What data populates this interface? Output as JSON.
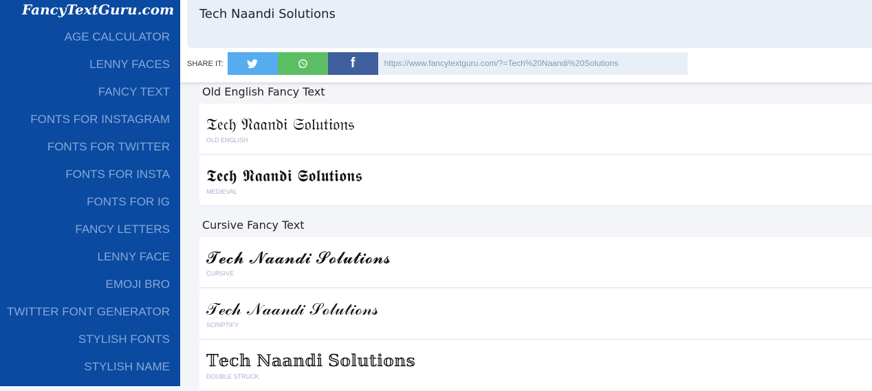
{
  "logo": "FancyTextGuru.com",
  "menu": [
    "AGE CALCULATOR",
    "LENNY FACES",
    "FANCY TEXT",
    "FONTS FOR INSTAGRAM",
    "FONTS FOR TWITTER",
    "FONTS FOR INSTA",
    "FONTS FOR IG",
    "FANCY LETTERS",
    "LENNY FACE",
    "EMOJI BRO",
    "TWITTER FONT GENERATOR",
    "STYLISH FONTS",
    "STYLISH NAME"
  ],
  "input": {
    "value": "Tech Naandi Solutions"
  },
  "share": {
    "label": "SHARE IT:",
    "url": "https://www.fancytextguru.com/?=Tech%20Naandi%20Solutions",
    "colors": {
      "twitter": "#55acee",
      "whatsapp": "#5cbe63",
      "facebook": "#3f5f9e"
    }
  },
  "sections": [
    {
      "title": "Old English Fancy Text",
      "items": [
        {
          "text": "𝔗𝔢𝔠𝔥 𝔑𝔞𝔞𝔫𝔡𝔦 𝔖𝔬𝔩𝔲𝔱𝔦𝔬𝔫𝔰",
          "name": "OLD ENGLISH"
        },
        {
          "text": "𝕿𝖊𝖈𝖍 𝕹𝖆𝖆𝖓𝖉𝖎 𝕾𝖔𝖑𝖚𝖙𝖎𝖔𝖓𝖘",
          "name": "MEDIEVAL"
        }
      ]
    },
    {
      "title": "Cursive Fancy Text",
      "items": [
        {
          "text": "𝓣𝓮𝓬𝓱 𝓝𝓪𝓪𝓷𝓭𝓲 𝓢𝓸𝓵𝓾𝓽𝓲𝓸𝓷𝓼",
          "name": "CURSIVE"
        },
        {
          "text": "𝒯ℯ𝒸𝒽 𝒩𝒶𝒶𝓃𝒹𝒾 𝒮ℴ𝓁𝓊𝓉𝒾ℴ𝓃𝓈",
          "name": "SCRIPTIFY"
        },
        {
          "text": "𝕋𝕖𝕔𝕙 ℕ𝕒𝕒𝕟𝕕𝕚 𝕊𝕠𝕝𝕦𝕥𝕚𝕠𝕟𝕤",
          "name": "DOUBLE STRUCK"
        }
      ]
    }
  ]
}
